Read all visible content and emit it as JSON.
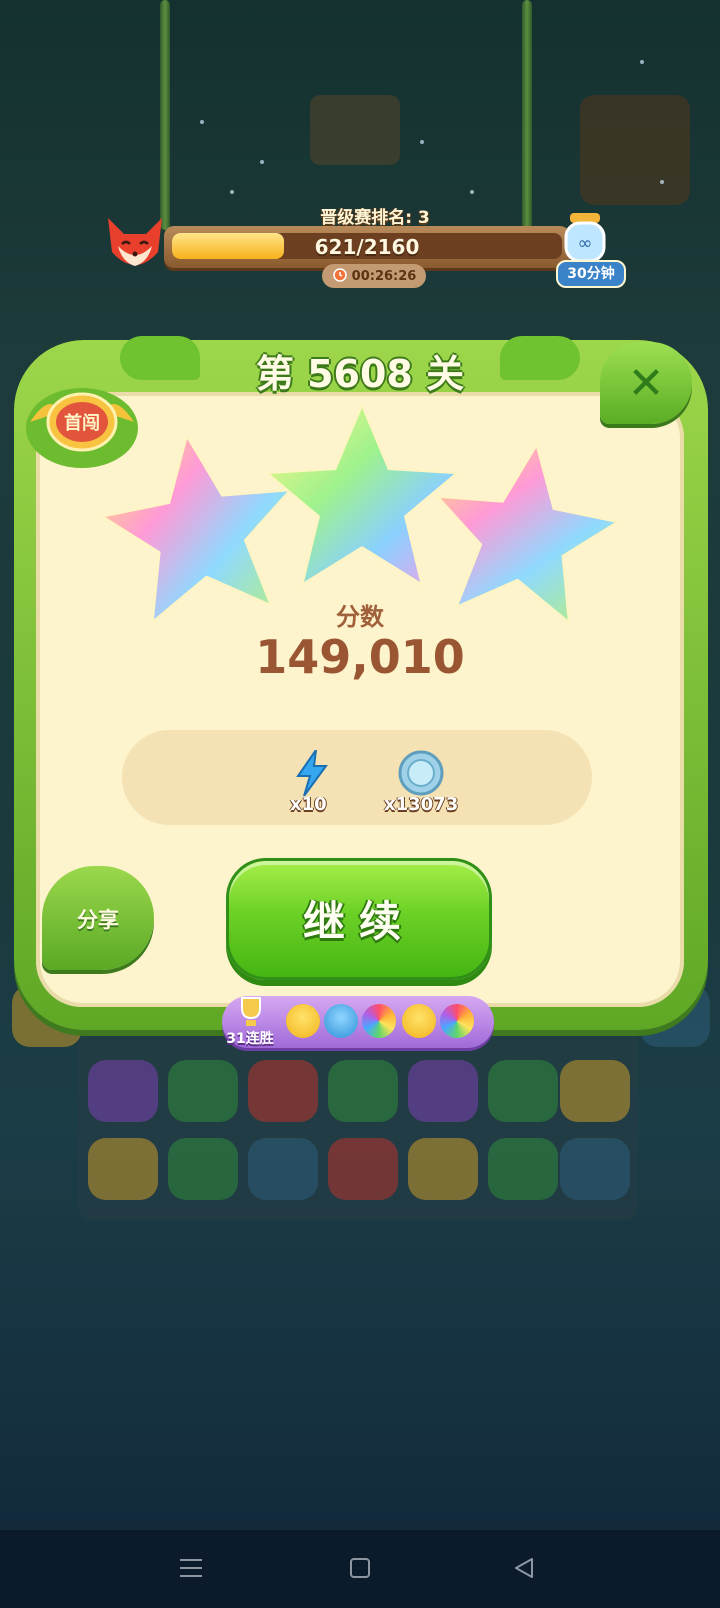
{
  "hud": {
    "rank_label": "晋级赛排名: 3",
    "progress_text": "621/2160",
    "progress_fraction": 0.2875,
    "timer": "00:26:26",
    "bottle_label": "30分钟"
  },
  "panel": {
    "level_title": "第 5608 关",
    "badge_label": "首闯",
    "stars_earned": 3,
    "score_label": "分数",
    "score_value": "149,010",
    "rewards": [
      {
        "icon": "lightning-icon",
        "count": "x10"
      },
      {
        "icon": "coin-icon",
        "count": "x13073"
      }
    ],
    "share_label": "分享",
    "continue_label": "继续",
    "streak_label": "31连胜",
    "streak_icons": [
      "chick-icon",
      "blue-owl-icon",
      "rainbow-owl-icon",
      "chick-icon",
      "rainbow-owl-icon"
    ]
  },
  "colors": {
    "panel_green": "#6cc22f",
    "panel_cream": "#fdf3cc",
    "score_brown": "#9a5532",
    "button_green": "#5ccb1c",
    "streak_purple": "#b27fe2"
  }
}
